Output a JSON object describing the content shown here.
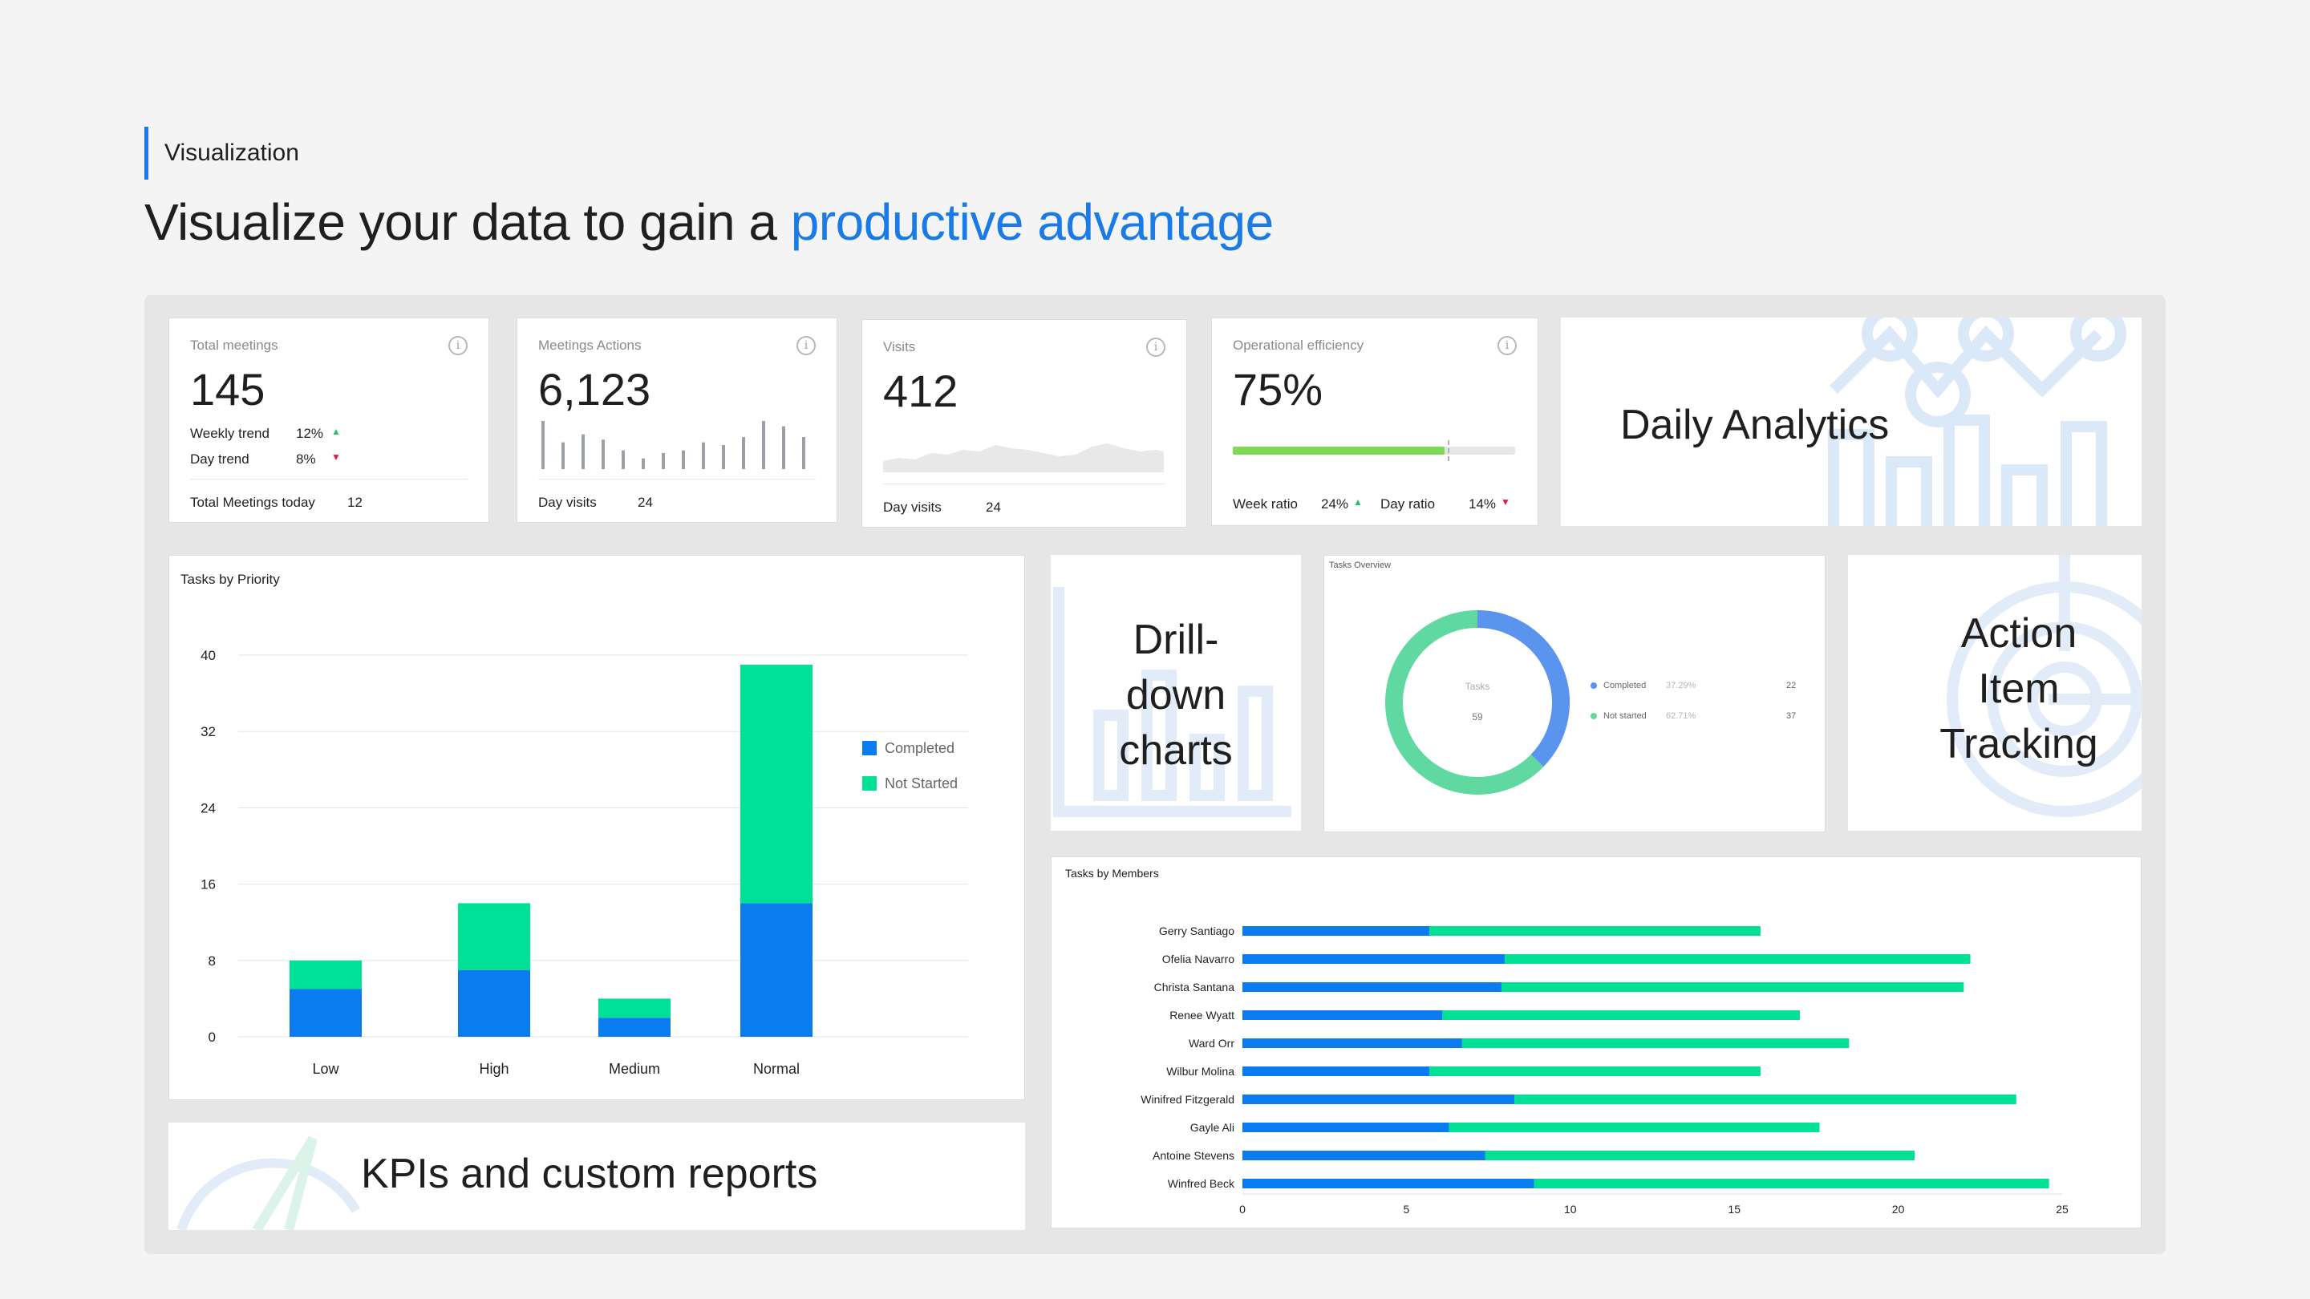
{
  "page": {
    "eyebrow": "Visualization",
    "headline_main": "Visualize your data to gain a ",
    "headline_accent": "productive advantage"
  },
  "colors": {
    "accent": "#1a7ae6",
    "completed": "#0b7cf0",
    "not_started": "#00e096",
    "line_green": "#7ed957",
    "muted_bar": "#9aa0a6"
  },
  "kpis": [
    {
      "title": "Total meetings",
      "value": "145",
      "weekly_label": "Weekly trend",
      "weekly_value": "12%",
      "day_label": "Day trend",
      "day_value": "8%",
      "footer_label": "Total Meetings today",
      "footer_value": "12"
    },
    {
      "title": "Meetings Actions",
      "value": "6,123",
      "footer_label": "Day visits",
      "footer_value": "24",
      "bars": [
        36,
        20,
        26,
        22,
        14,
        8,
        12,
        14,
        20,
        18,
        24,
        36,
        32,
        24
      ]
    },
    {
      "title": "Visits",
      "value": "412",
      "footer_label": "Day visits",
      "footer_value": "24"
    },
    {
      "title": "Operational efficiency",
      "value": "75%",
      "progress": 0.75,
      "week_label": "Week ratio",
      "week_value": "24%",
      "day_label": "Day ratio",
      "day_value": "14%"
    }
  ],
  "promos": {
    "daily_analytics": "Daily Analytics",
    "drill_down_1": "Drill-",
    "drill_down_2": "down",
    "drill_down_3": "charts",
    "action_1": "Action",
    "action_2": "Item",
    "action_3": "Tracking",
    "kpis_reports": "KPIs and custom reports"
  },
  "tasks_overview": {
    "title": "Tasks Overview",
    "center_label": "Tasks",
    "center_value": "59",
    "legend": [
      {
        "label": "Completed",
        "percent": "37.29%",
        "count": "22",
        "value": 22
      },
      {
        "label": "Not started",
        "percent": "62.71%",
        "count": "37",
        "value": 37
      }
    ]
  },
  "chart_data": [
    {
      "type": "bar",
      "title": "Tasks by Priority",
      "stacked": true,
      "categories": [
        "Low",
        "High",
        "Medium",
        "Normal"
      ],
      "series": [
        {
          "name": "Completed",
          "values": [
            5,
            7,
            2,
            14
          ]
        },
        {
          "name": "Not Started",
          "values": [
            3,
            7,
            2,
            25
          ]
        }
      ],
      "ylim": [
        0,
        40
      ],
      "yticks": [
        0,
        8,
        16,
        24,
        32,
        40
      ],
      "grid": true,
      "legend": "right"
    },
    {
      "type": "bar",
      "orientation": "horizontal",
      "title": "Tasks by Members",
      "stacked": true,
      "categories": [
        "Gerry Santiago",
        "Ofelia Navarro",
        "Christa Santana",
        "Renee Wyatt",
        "Ward Orr",
        "Wilbur Molina",
        "Winifred Fitzgerald",
        "Gayle Ali",
        "Antoine Stevens",
        "Winfred Beck"
      ],
      "series": [
        {
          "name": "Completed",
          "values": [
            5.7,
            8,
            7.9,
            6.1,
            6.7,
            5.7,
            8.3,
            6.3,
            7.4,
            8.9
          ]
        },
        {
          "name": "Not Started",
          "values": [
            10.1,
            14.2,
            14.1,
            10.9,
            11.8,
            10.1,
            15.3,
            11.3,
            13.1,
            15.7
          ]
        }
      ],
      "xlim": [
        0,
        25
      ],
      "xticks": [
        0,
        5,
        10,
        15,
        20,
        25
      ]
    }
  ]
}
